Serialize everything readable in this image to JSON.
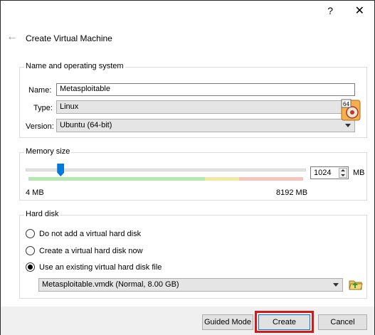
{
  "titlebar": {
    "help_label": "?",
    "close_label": "✕"
  },
  "header": {
    "title": "Create Virtual Machine"
  },
  "name_os": {
    "legend": "Name and operating system",
    "name_label": "Name:",
    "name_value": "Metasploitable",
    "type_label": "Type:",
    "type_value": "Linux",
    "version_label": "Version:",
    "version_value": "Ubuntu (64-bit)",
    "os_badge": "64"
  },
  "memory": {
    "legend": "Memory size",
    "value": "1024",
    "unit": "MB",
    "min_label": "4 MB",
    "max_label": "8192 MB",
    "slider_fraction": 0.125
  },
  "hard_disk": {
    "legend": "Hard disk",
    "options": [
      {
        "label": "Do not add a virtual hard disk",
        "checked": false
      },
      {
        "label": "Create a virtual hard disk now",
        "checked": false
      },
      {
        "label": "Use an existing virtual hard disk file",
        "checked": true
      }
    ],
    "selected_file": "Metasploitable.vmdk (Normal, 8.00 GB)"
  },
  "footer": {
    "guided_mode_label": "Guided Mode",
    "create_label": "Create",
    "cancel_label": "Cancel"
  },
  "colors": {
    "accent": "#0078d7",
    "highlight": "#d11a1a",
    "slider_green": "#b7e7b0",
    "slider_yellow": "#f3e7a5",
    "slider_red": "#f7c3bd"
  },
  "icons": {
    "back": "arrow-left-icon",
    "os": "ubuntu-64-icon",
    "folder": "folder-open-icon"
  }
}
